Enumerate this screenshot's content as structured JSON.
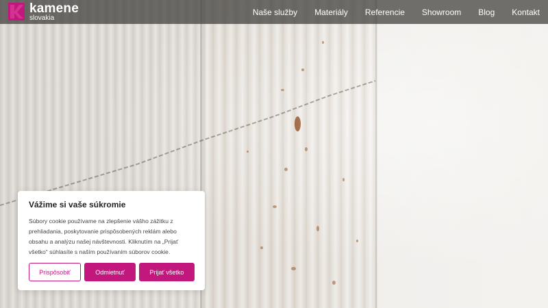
{
  "brand": {
    "name": "kamene",
    "sub": "slovakia",
    "accent": "#c2187e",
    "logo_icon": "k-logo-icon"
  },
  "nav": {
    "items": [
      {
        "label": "Naše služby"
      },
      {
        "label": "Materiály"
      },
      {
        "label": "Referencie"
      },
      {
        "label": "Showroom"
      },
      {
        "label": "Blog"
      },
      {
        "label": "Kontakt"
      }
    ]
  },
  "hero": {
    "image": "fluted travertine stone wall"
  },
  "cookie": {
    "title": "Vážime si vaše súkromie",
    "text": "Súbory cookie používame na zlepšenie vášho zážitku z prehliadania, poskytovanie prispôsobených reklám alebo obsahu a analýzu našej návštevnosti. Kliknutím na „Prijať všetko“ súhlasíte s naším používaním súborov cookie.",
    "customize_label": "Prispôsobiť",
    "reject_label": "Odmietnuť",
    "accept_label": "Prijať všetko"
  }
}
